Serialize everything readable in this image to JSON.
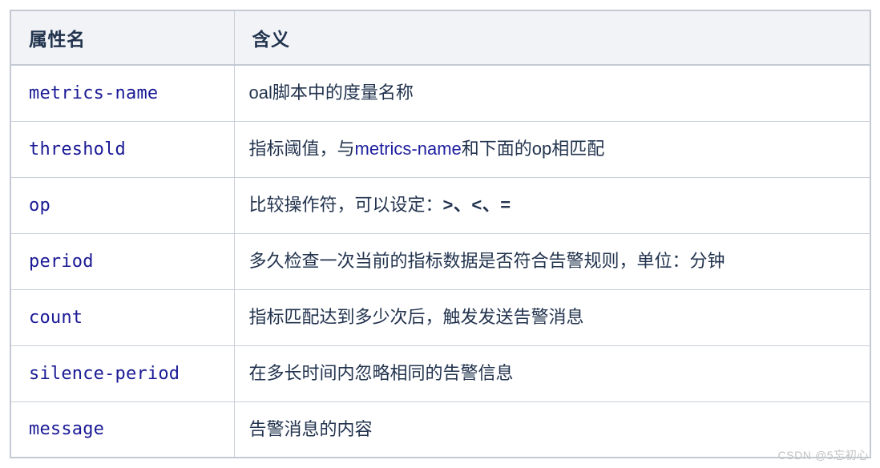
{
  "table": {
    "headers": {
      "name": "属性名",
      "meaning": "含义"
    },
    "rows": [
      {
        "name": "metrics-name",
        "meaning_prefix": "oal脚本中的度量名称",
        "meaning_code": "",
        "meaning_suffix": "",
        "meaning_ops": ""
      },
      {
        "name": "threshold",
        "meaning_prefix": "指标阈值，与",
        "meaning_code": "metrics-name",
        "meaning_suffix": "和下面的op相匹配",
        "meaning_ops": ""
      },
      {
        "name": "op",
        "meaning_prefix": "比较操作符，可以设定：",
        "meaning_code": "",
        "meaning_suffix": "",
        "meaning_ops": ">、<、="
      },
      {
        "name": "period",
        "meaning_prefix": "多久检查一次当前的指标数据是否符合告警规则，单位：分钟",
        "meaning_code": "",
        "meaning_suffix": "",
        "meaning_ops": ""
      },
      {
        "name": "count",
        "meaning_prefix": "指标匹配达到多少次后，触发发送告警消息",
        "meaning_code": "",
        "meaning_suffix": "",
        "meaning_ops": ""
      },
      {
        "name": "silence-period",
        "meaning_prefix": "在多长时间内忽略相同的告警信息",
        "meaning_code": "",
        "meaning_suffix": "",
        "meaning_ops": ""
      },
      {
        "name": "message",
        "meaning_prefix": "告警消息的内容",
        "meaning_code": "",
        "meaning_suffix": "",
        "meaning_ops": ""
      }
    ]
  },
  "watermark": {
    "text": "CSDN @5忘初心"
  },
  "colors": {
    "header_bg": "#f1f3f6",
    "border": "#c9d0da",
    "outer_border": "#c3cad4",
    "heading_text": "#22334e",
    "code_text": "#1a1a96",
    "body_text": "#22334e",
    "watermark_text": "#c2c2c2"
  }
}
